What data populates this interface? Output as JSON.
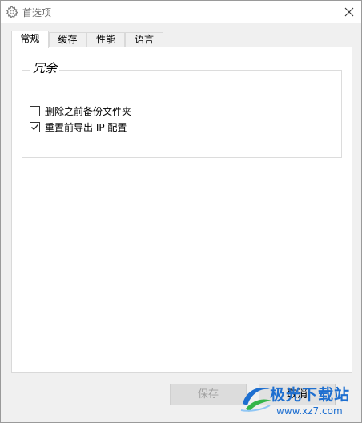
{
  "window": {
    "title": "首选项",
    "icon": "gear-icon",
    "close_icon": "close-icon"
  },
  "tabs": [
    {
      "label": "常规",
      "active": true
    },
    {
      "label": "缓存",
      "active": false
    },
    {
      "label": "性能",
      "active": false
    },
    {
      "label": "语言",
      "active": false
    }
  ],
  "redundancy_group": {
    "label": "冗余",
    "options": [
      {
        "label": "删除之前备份文件夹",
        "checked": false
      },
      {
        "label": "重置前导出 IP 配置",
        "checked": true
      }
    ]
  },
  "footer": {
    "save_label": "保存",
    "save_enabled": false,
    "cancel_label": "取消"
  },
  "watermark": {
    "brand": "极光下载站",
    "url": "www.xz7.com",
    "colors": {
      "primary": "#1e6fd0",
      "accent": "#35b54a"
    }
  }
}
